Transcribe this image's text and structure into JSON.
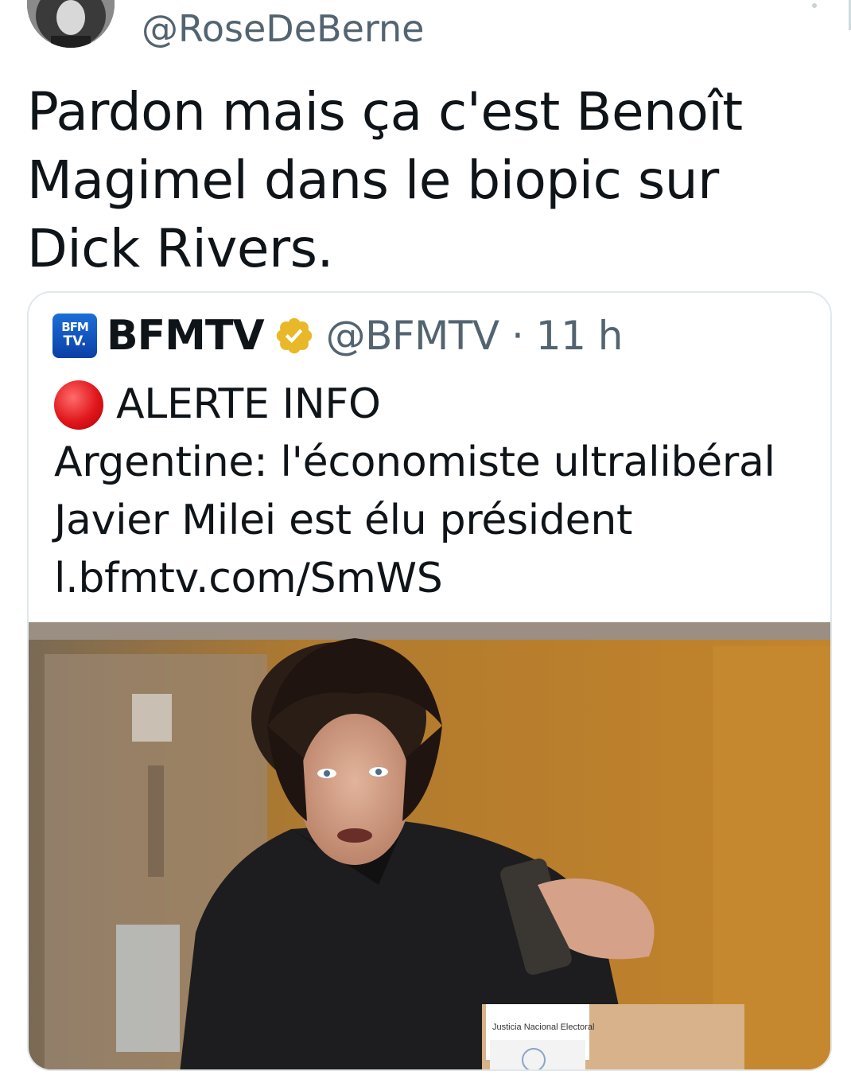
{
  "tweet": {
    "author_handle": "@RoseDeBerne",
    "text": "Pardon mais ça c'est Benoît Magimel dans le biopic sur Dick Rivers."
  },
  "quoted_tweet": {
    "logo_line1": "BFM",
    "logo_line2": "TV.",
    "display_name": "BFMTV",
    "handle": "@BFMTV",
    "separator": " · ",
    "time": "11 h",
    "alert_label": "ALERTE INFO",
    "body": "Argentine: l'économiste ultralibéral Javier Milei est élu président",
    "link": "l.bfmtv.com/SmWS",
    "photo": {
      "ballot_box_label": "Justicia Nacional Electoral"
    }
  },
  "colors": {
    "text": "#0f1419",
    "secondary": "#536471",
    "border": "#e1e8ed",
    "verified_gold": "#e8b829",
    "alert_red": "#e0161b"
  },
  "icons": [
    "avatar",
    "bfmtv-logo-icon",
    "verified-badge-icon",
    "red-circle-icon"
  ]
}
